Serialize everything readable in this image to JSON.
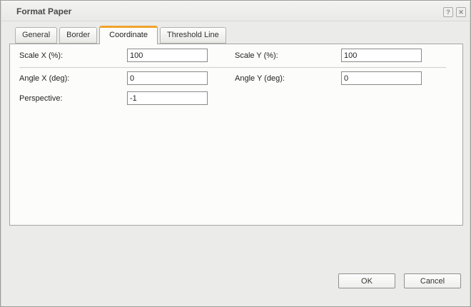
{
  "dialog": {
    "title": "Format Paper",
    "help_glyph": "?",
    "close_glyph": "✕"
  },
  "tabs": [
    {
      "label": "General",
      "active": false
    },
    {
      "label": "Border",
      "active": false
    },
    {
      "label": "Coordinate",
      "active": true
    },
    {
      "label": "Threshold Line",
      "active": false
    }
  ],
  "form": {
    "scale_x": {
      "label": "Scale X (%):",
      "value": "100"
    },
    "scale_y": {
      "label": "Scale Y (%):",
      "value": "100"
    },
    "angle_x": {
      "label": "Angle X (deg):",
      "value": "0"
    },
    "angle_y": {
      "label": "Angle Y (deg):",
      "value": "0"
    },
    "perspective": {
      "label": "Perspective:",
      "value": "-1"
    }
  },
  "footer": {
    "ok_label": "OK",
    "cancel_label": "Cancel"
  },
  "colors": {
    "accent_orange": "#F0A22D",
    "dialog_background": "#EBEBE9",
    "panel_background": "#FCFDFB",
    "border_gray": "#A5A5A2"
  }
}
